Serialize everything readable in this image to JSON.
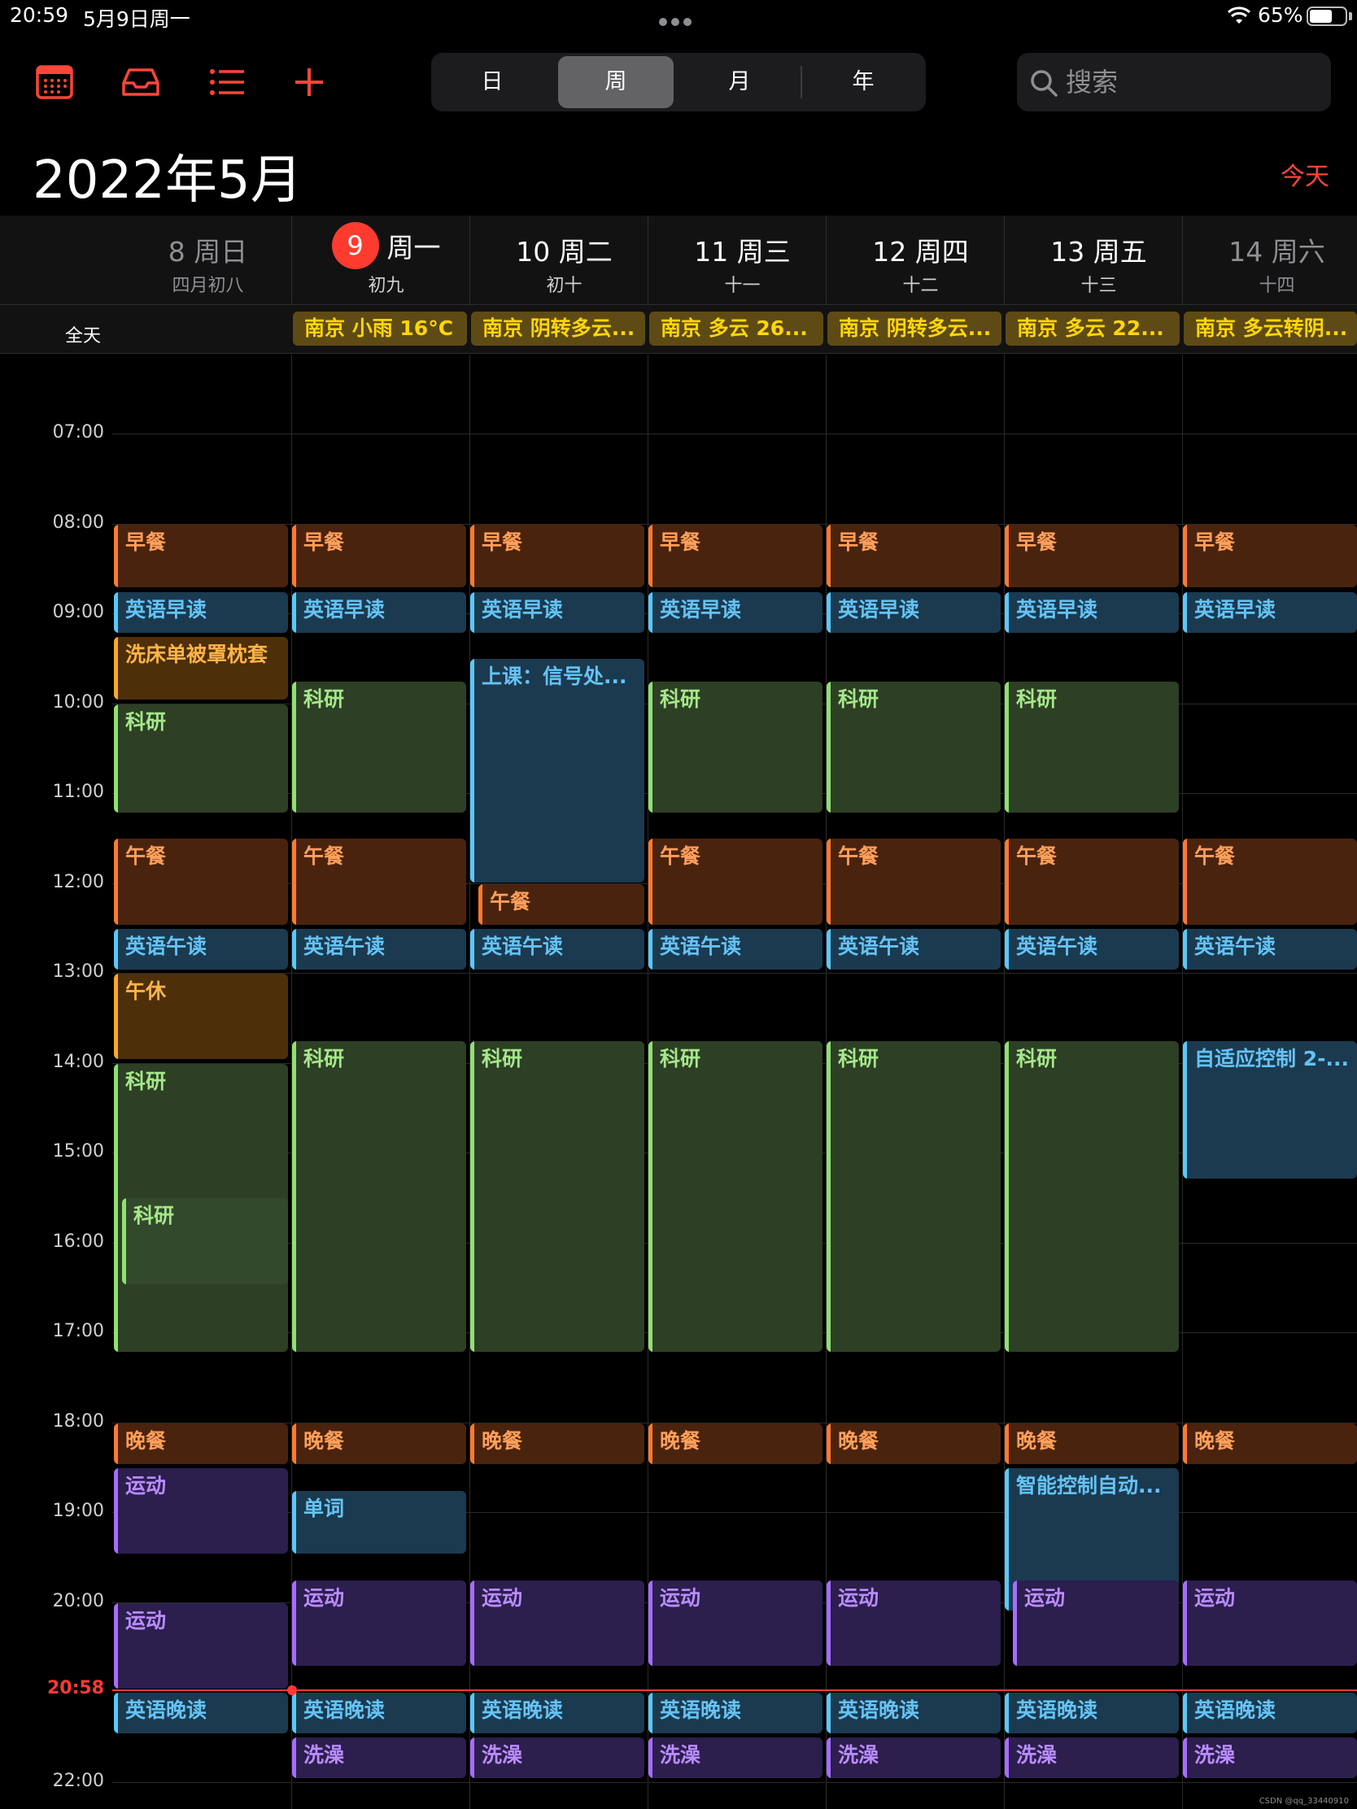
{
  "status": {
    "time": "20:59",
    "date": "5月9日周一",
    "battery": "65%",
    "battery_level": 0.65
  },
  "toolbar": {
    "view_options": [
      "日",
      "周",
      "月",
      "年"
    ],
    "active_view": "周",
    "search_placeholder": "搜索"
  },
  "header": {
    "month_title": "2022年5月",
    "today_button": "今天"
  },
  "days": [
    {
      "day": "8 周日",
      "lunar": "四月初八"
    },
    {
      "day": "周一",
      "lunar": "初九",
      "today_number": "9"
    },
    {
      "day": "10 周二",
      "lunar": "初十"
    },
    {
      "day": "11 周三",
      "lunar": "十一"
    },
    {
      "day": "12 周四",
      "lunar": "十二"
    },
    {
      "day": "13 周五",
      "lunar": "十三"
    },
    {
      "day": "14 周六",
      "lunar": "十四"
    }
  ],
  "allday": {
    "label": "全天",
    "weather": [
      "南京 小雨 16°C",
      "南京 阴转多云...",
      "南京 多云 26...",
      "南京 阴转多云...",
      "南京 多云 22...",
      "南京 多云转阴..."
    ]
  },
  "timeline": {
    "hours": [
      "07:00",
      "08:00",
      "09:00",
      "10:00",
      "11:00",
      "12:00",
      "13:00",
      "14:00",
      "15:00",
      "16:00",
      "17:00",
      "18:00",
      "19:00",
      "20:00",
      "22:00"
    ],
    "now_label": "20:58"
  },
  "events": [
    {
      "day": 0,
      "title": "早餐",
      "color": "orange",
      "start": 8.0,
      "end": 8.72
    },
    {
      "day": 0,
      "title": "英语早读",
      "color": "blue",
      "start": 8.75,
      "end": 9.22
    },
    {
      "day": 0,
      "title": "洗床单被罩枕套",
      "color": "amber",
      "start": 9.25,
      "end": 9.97
    },
    {
      "day": 0,
      "title": "科研",
      "color": "green",
      "start": 10.0,
      "end": 11.22
    },
    {
      "day": 0,
      "title": "午餐",
      "color": "orange",
      "start": 11.5,
      "end": 12.47
    },
    {
      "day": 0,
      "title": "英语午读",
      "color": "blue",
      "start": 12.5,
      "end": 12.97
    },
    {
      "day": 0,
      "title": "午休",
      "color": "amber",
      "start": 13.0,
      "end": 13.97
    },
    {
      "day": 0,
      "title": "科研",
      "color": "green",
      "start": 14.0,
      "end": 17.22
    },
    {
      "day": 0,
      "title": "科研",
      "color": "green2",
      "start": 15.5,
      "end": 16.47,
      "inset": true
    },
    {
      "day": 0,
      "title": "晚餐",
      "color": "orange",
      "start": 18.0,
      "end": 18.47
    },
    {
      "day": 0,
      "title": "运动",
      "color": "purple",
      "start": 18.5,
      "end": 19.47
    },
    {
      "day": 0,
      "title": "运动",
      "color": "purple",
      "start": 20.0,
      "end": 20.97
    },
    {
      "day": 0,
      "title": "英语晚读",
      "color": "blue",
      "start": 21.0,
      "end": 21.47
    },
    {
      "day": 1,
      "title": "早餐",
      "color": "orange",
      "start": 8.0,
      "end": 8.72
    },
    {
      "day": 1,
      "title": "英语早读",
      "color": "blue",
      "start": 8.75,
      "end": 9.22
    },
    {
      "day": 1,
      "title": "科研",
      "color": "green",
      "start": 9.75,
      "end": 11.22
    },
    {
      "day": 1,
      "title": "午餐",
      "color": "orange",
      "start": 11.5,
      "end": 12.47
    },
    {
      "day": 1,
      "title": "英语午读",
      "color": "blue",
      "start": 12.5,
      "end": 12.97
    },
    {
      "day": 1,
      "title": "科研",
      "color": "green",
      "start": 13.75,
      "end": 17.22
    },
    {
      "day": 1,
      "title": "晚餐",
      "color": "orange",
      "start": 18.0,
      "end": 18.47
    },
    {
      "day": 1,
      "title": "单词",
      "color": "blue",
      "start": 18.75,
      "end": 19.47
    },
    {
      "day": 1,
      "title": "运动",
      "color": "purple",
      "start": 19.75,
      "end": 20.72
    },
    {
      "day": 1,
      "title": "英语晚读",
      "color": "blue",
      "start": 21.0,
      "end": 21.47
    },
    {
      "day": 1,
      "title": "洗澡",
      "color": "purple",
      "start": 21.5,
      "end": 21.97
    },
    {
      "day": 2,
      "title": "早餐",
      "color": "orange",
      "start": 8.0,
      "end": 8.72
    },
    {
      "day": 2,
      "title": "英语早读",
      "color": "blue",
      "start": 8.75,
      "end": 9.22
    },
    {
      "day": 2,
      "title": "上课：信号处...",
      "color": "blue",
      "start": 9.5,
      "end": 12.0
    },
    {
      "day": 2,
      "title": "午餐",
      "color": "orange",
      "start": 12.0,
      "end": 12.47,
      "inset": true
    },
    {
      "day": 2,
      "title": "英语午读",
      "color": "blue",
      "start": 12.5,
      "end": 12.97
    },
    {
      "day": 2,
      "title": "科研",
      "color": "green",
      "start": 13.75,
      "end": 17.22
    },
    {
      "day": 2,
      "title": "晚餐",
      "color": "orange",
      "start": 18.0,
      "end": 18.47
    },
    {
      "day": 2,
      "title": "运动",
      "color": "purple",
      "start": 19.75,
      "end": 20.72
    },
    {
      "day": 2,
      "title": "英语晚读",
      "color": "blue",
      "start": 21.0,
      "end": 21.47
    },
    {
      "day": 2,
      "title": "洗澡",
      "color": "purple",
      "start": 21.5,
      "end": 21.97
    },
    {
      "day": 3,
      "title": "早餐",
      "color": "orange",
      "start": 8.0,
      "end": 8.72
    },
    {
      "day": 3,
      "title": "英语早读",
      "color": "blue",
      "start": 8.75,
      "end": 9.22
    },
    {
      "day": 3,
      "title": "科研",
      "color": "green",
      "start": 9.75,
      "end": 11.22
    },
    {
      "day": 3,
      "title": "午餐",
      "color": "orange",
      "start": 11.5,
      "end": 12.47
    },
    {
      "day": 3,
      "title": "英语午读",
      "color": "blue",
      "start": 12.5,
      "end": 12.97
    },
    {
      "day": 3,
      "title": "科研",
      "color": "green",
      "start": 13.75,
      "end": 17.22
    },
    {
      "day": 3,
      "title": "晚餐",
      "color": "orange",
      "start": 18.0,
      "end": 18.47
    },
    {
      "day": 3,
      "title": "运动",
      "color": "purple",
      "start": 19.75,
      "end": 20.72
    },
    {
      "day": 3,
      "title": "英语晚读",
      "color": "blue",
      "start": 21.0,
      "end": 21.47
    },
    {
      "day": 3,
      "title": "洗澡",
      "color": "purple",
      "start": 21.5,
      "end": 21.97
    },
    {
      "day": 4,
      "title": "早餐",
      "color": "orange",
      "start": 8.0,
      "end": 8.72
    },
    {
      "day": 4,
      "title": "英语早读",
      "color": "blue",
      "start": 8.75,
      "end": 9.22
    },
    {
      "day": 4,
      "title": "科研",
      "color": "green",
      "start": 9.75,
      "end": 11.22
    },
    {
      "day": 4,
      "title": "午餐",
      "color": "orange",
      "start": 11.5,
      "end": 12.47
    },
    {
      "day": 4,
      "title": "英语午读",
      "color": "blue",
      "start": 12.5,
      "end": 12.97
    },
    {
      "day": 4,
      "title": "科研",
      "color": "green",
      "start": 13.75,
      "end": 17.22
    },
    {
      "day": 4,
      "title": "晚餐",
      "color": "orange",
      "start": 18.0,
      "end": 18.47
    },
    {
      "day": 4,
      "title": "运动",
      "color": "purple",
      "start": 19.75,
      "end": 20.72
    },
    {
      "day": 4,
      "title": "英语晚读",
      "color": "blue",
      "start": 21.0,
      "end": 21.47
    },
    {
      "day": 4,
      "title": "洗澡",
      "color": "purple",
      "start": 21.5,
      "end": 21.97
    },
    {
      "day": 5,
      "title": "早餐",
      "color": "orange",
      "start": 8.0,
      "end": 8.72
    },
    {
      "day": 5,
      "title": "英语早读",
      "color": "blue",
      "start": 8.75,
      "end": 9.22
    },
    {
      "day": 5,
      "title": "科研",
      "color": "green",
      "start": 9.75,
      "end": 11.22
    },
    {
      "day": 5,
      "title": "午餐",
      "color": "orange",
      "start": 11.5,
      "end": 12.47
    },
    {
      "day": 5,
      "title": "英语午读",
      "color": "blue",
      "start": 12.5,
      "end": 12.97
    },
    {
      "day": 5,
      "title": "科研",
      "color": "green",
      "start": 13.75,
      "end": 17.22
    },
    {
      "day": 5,
      "title": "晚餐",
      "color": "orange",
      "start": 18.0,
      "end": 18.47
    },
    {
      "day": 5,
      "title": "智能控制自动...",
      "color": "blue",
      "start": 18.5,
      "end": 20.1
    },
    {
      "day": 5,
      "title": "运动",
      "color": "purple",
      "start": 19.75,
      "end": 20.72,
      "inset": true
    },
    {
      "day": 5,
      "title": "英语晚读",
      "color": "blue",
      "start": 21.0,
      "end": 21.47
    },
    {
      "day": 5,
      "title": "洗澡",
      "color": "purple",
      "start": 21.5,
      "end": 21.97
    },
    {
      "day": 6,
      "title": "早餐",
      "color": "orange",
      "start": 8.0,
      "end": 8.72
    },
    {
      "day": 6,
      "title": "英语早读",
      "color": "blue",
      "start": 8.75,
      "end": 9.22
    },
    {
      "day": 6,
      "title": "午餐",
      "color": "orange",
      "start": 11.5,
      "end": 12.47
    },
    {
      "day": 6,
      "title": "英语午读",
      "color": "blue",
      "start": 12.5,
      "end": 12.97
    },
    {
      "day": 6,
      "title": "自适应控制 2-...",
      "color": "blue",
      "start": 13.75,
      "end": 15.3
    },
    {
      "day": 6,
      "title": "晚餐",
      "color": "orange",
      "start": 18.0,
      "end": 18.47
    },
    {
      "day": 6,
      "title": "运动",
      "color": "purple",
      "start": 19.75,
      "end": 20.72
    },
    {
      "day": 6,
      "title": "英语晚读",
      "color": "blue",
      "start": 21.0,
      "end": 21.47
    },
    {
      "day": 6,
      "title": "洗澡",
      "color": "purple",
      "start": 21.5,
      "end": 21.97
    }
  ],
  "credit": "CSDN @qq_33440910"
}
